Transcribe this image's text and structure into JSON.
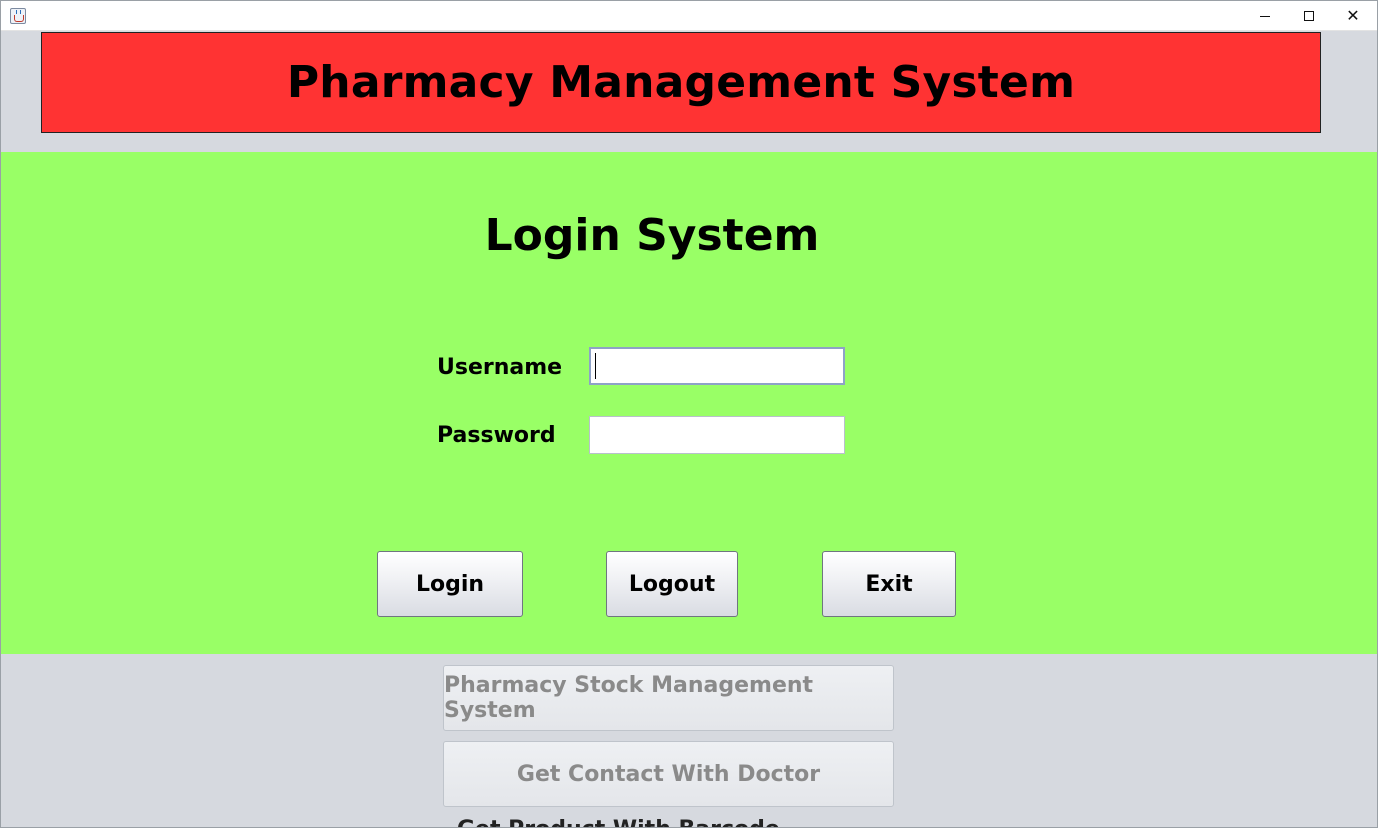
{
  "window": {
    "app_icon": "java-cup-icon",
    "controls": {
      "minimize_icon": "minimize-icon",
      "maximize_icon": "maximize-icon",
      "close_icon": "close-icon",
      "close_glyph": "✕"
    }
  },
  "header": {
    "title": "Pharmacy Management System",
    "background": "#ff3333"
  },
  "login": {
    "title": "Login System",
    "background": "#99ff66",
    "username_label": "Username",
    "password_label": "Password",
    "username_value": "",
    "password_value": "",
    "buttons": {
      "login": "Login",
      "logout": "Logout",
      "exit": "Exit"
    }
  },
  "footer": {
    "stock_button": "Pharmacy Stock Management System",
    "doctor_button": "Get Contact With Doctor",
    "partial_text": "Get Product With Barcode"
  }
}
